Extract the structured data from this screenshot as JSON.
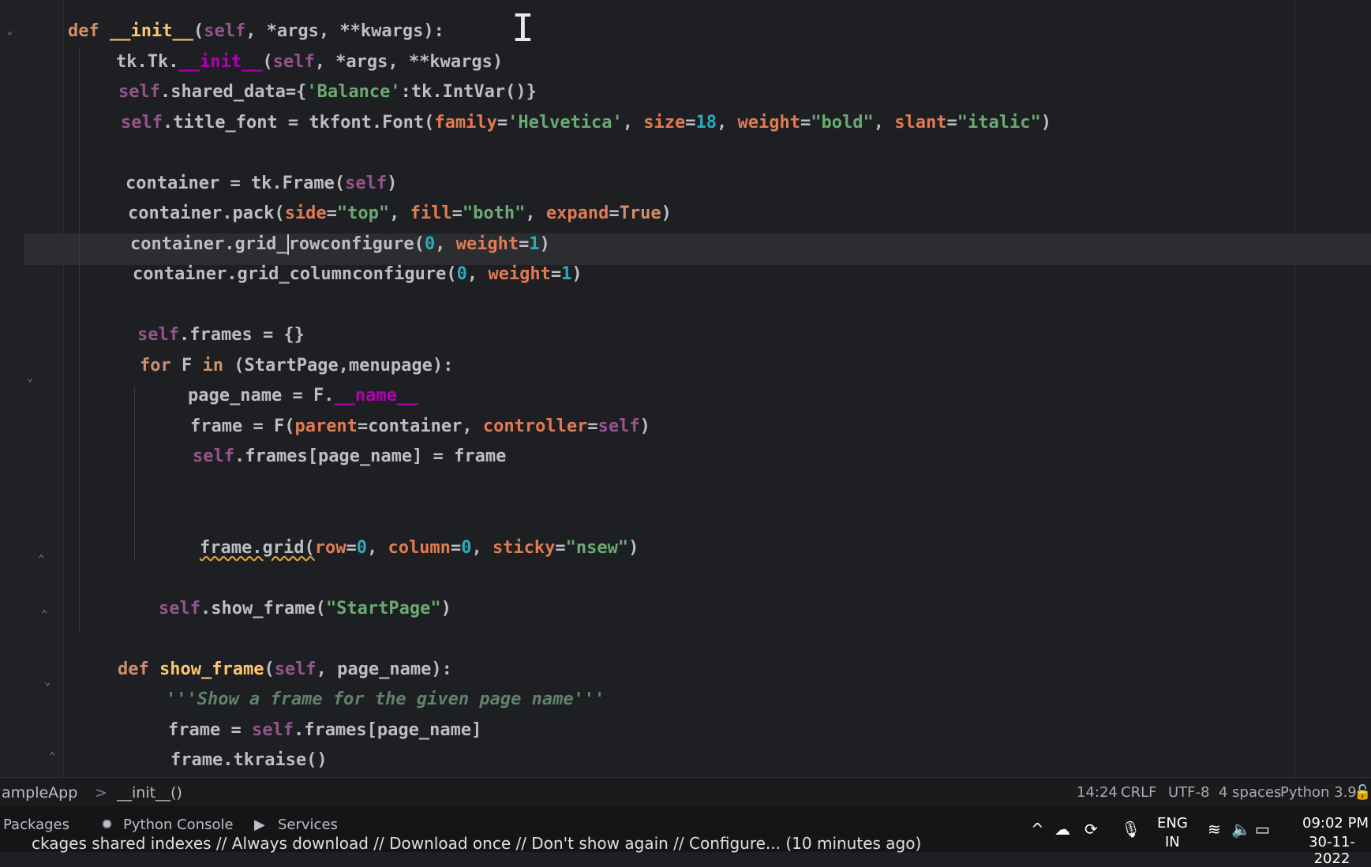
{
  "editor": {
    "lines": [
      {
        "indent": 0,
        "tokens": [
          [
            "kw",
            "def "
          ],
          [
            "def",
            "__init__"
          ],
          [
            "plain",
            "("
          ],
          [
            "self",
            "self"
          ],
          [
            "plain",
            ", *args, **kwargs):"
          ]
        ]
      },
      {
        "indent": 1,
        "tokens": [
          [
            "plain",
            "tk.Tk."
          ],
          [
            "dunder",
            "__init__"
          ],
          [
            "plain",
            "("
          ],
          [
            "self",
            "self"
          ],
          [
            "plain",
            ", *args, **kwargs)"
          ]
        ]
      },
      {
        "indent": 1,
        "tokens": [
          [
            "self",
            "self"
          ],
          [
            "plain",
            ".shared_data={"
          ],
          [
            "str",
            "'Balance'"
          ],
          [
            "plain",
            ":tk.IntVar()}"
          ]
        ]
      },
      {
        "indent": 1,
        "tokens": [
          [
            "self",
            "self"
          ],
          [
            "plain",
            ".title_font = tkfont.Font("
          ],
          [
            "param",
            "family"
          ],
          [
            "plain",
            "="
          ],
          [
            "str",
            "'Helvetica'"
          ],
          [
            "plain",
            ", "
          ],
          [
            "param",
            "size"
          ],
          [
            "plain",
            "="
          ],
          [
            "num",
            "18"
          ],
          [
            "plain",
            ", "
          ],
          [
            "param",
            "weight"
          ],
          [
            "plain",
            "="
          ],
          [
            "str",
            "\"bold\""
          ],
          [
            "plain",
            ", "
          ],
          [
            "param",
            "slant"
          ],
          [
            "plain",
            "="
          ],
          [
            "str",
            "\"italic\""
          ],
          [
            "plain",
            ")"
          ]
        ]
      },
      {
        "indent": 1,
        "tokens": []
      },
      {
        "indent": 1,
        "tokens": [
          [
            "plain",
            "container = tk.Frame("
          ],
          [
            "self",
            "self"
          ],
          [
            "plain",
            ")"
          ]
        ]
      },
      {
        "indent": 1,
        "tokens": [
          [
            "plain",
            "container.pack("
          ],
          [
            "param",
            "side"
          ],
          [
            "plain",
            "="
          ],
          [
            "str",
            "\"top\""
          ],
          [
            "plain",
            ", "
          ],
          [
            "param",
            "fill"
          ],
          [
            "plain",
            "="
          ],
          [
            "str",
            "\"both\""
          ],
          [
            "plain",
            ", "
          ],
          [
            "param",
            "expand"
          ],
          [
            "plain",
            "="
          ],
          [
            "kw",
            "True"
          ],
          [
            "plain",
            ")"
          ]
        ]
      },
      {
        "indent": 1,
        "tokens": [
          [
            "plain",
            "container.grid_"
          ],
          [
            "cursor",
            ""
          ],
          [
            "plain",
            "rowconfigure("
          ],
          [
            "num",
            "0"
          ],
          [
            "plain",
            ", "
          ],
          [
            "param",
            "weight"
          ],
          [
            "plain",
            "="
          ],
          [
            "num",
            "1"
          ],
          [
            "plain",
            ")"
          ]
        ]
      },
      {
        "indent": 1,
        "tokens": [
          [
            "plain",
            "container.grid_columnconfigure("
          ],
          [
            "num",
            "0"
          ],
          [
            "plain",
            ", "
          ],
          [
            "param",
            "weight"
          ],
          [
            "plain",
            "="
          ],
          [
            "num",
            "1"
          ],
          [
            "plain",
            ")"
          ]
        ]
      },
      {
        "indent": 1,
        "tokens": []
      },
      {
        "indent": 1,
        "tokens": [
          [
            "self",
            "self"
          ],
          [
            "plain",
            ".frames = {}"
          ]
        ]
      },
      {
        "indent": 1,
        "tokens": [
          [
            "kw",
            "for "
          ],
          [
            "plain",
            "F "
          ],
          [
            "kw",
            "in "
          ],
          [
            "plain",
            "(StartPage,menupage):"
          ]
        ]
      },
      {
        "indent": 2,
        "tokens": [
          [
            "plain",
            "page_name = F."
          ],
          [
            "dunder",
            "__name__"
          ]
        ]
      },
      {
        "indent": 2,
        "tokens": [
          [
            "plain",
            "frame = F("
          ],
          [
            "param",
            "parent"
          ],
          [
            "plain",
            "=container, "
          ],
          [
            "param",
            "controller"
          ],
          [
            "plain",
            "="
          ],
          [
            "self",
            "self"
          ],
          [
            "plain",
            ")"
          ]
        ]
      },
      {
        "indent": 2,
        "tokens": [
          [
            "self",
            "self"
          ],
          [
            "plain",
            ".frames[page_name] = frame"
          ]
        ]
      },
      {
        "indent": 2,
        "tokens": []
      },
      {
        "indent": 2,
        "tokens": []
      },
      {
        "indent": 2,
        "tokens": [
          [
            "under",
            "frame.grid("
          ],
          [
            "param",
            "row"
          ],
          [
            "plain",
            "="
          ],
          [
            "num",
            "0"
          ],
          [
            "plain",
            ", "
          ],
          [
            "param",
            "column"
          ],
          [
            "plain",
            "="
          ],
          [
            "num",
            "0"
          ],
          [
            "plain",
            ", "
          ],
          [
            "param",
            "sticky"
          ],
          [
            "plain",
            "="
          ],
          [
            "str",
            "\"nsew\""
          ],
          [
            "plain",
            ")"
          ]
        ]
      },
      {
        "indent": 1,
        "tokens": []
      },
      {
        "indent": 1,
        "tokens": [
          [
            "self",
            "self"
          ],
          [
            "plain",
            ".show_frame("
          ],
          [
            "str",
            "\"StartPage\""
          ],
          [
            "plain",
            ")"
          ]
        ]
      },
      {
        "indent": 0,
        "tokens": []
      },
      {
        "indent": 0,
        "tokens": [
          [
            "kw",
            "def "
          ],
          [
            "def",
            "show_frame"
          ],
          [
            "plain",
            "("
          ],
          [
            "self",
            "self"
          ],
          [
            "plain",
            ", page_name):"
          ]
        ]
      },
      {
        "indent": 1,
        "tokens": [
          [
            "doc",
            "'''Show a frame for the given page name'''"
          ]
        ]
      },
      {
        "indent": 1,
        "tokens": [
          [
            "plain",
            "frame = "
          ],
          [
            "self",
            "self"
          ],
          [
            "plain",
            ".frames[page_name]"
          ]
        ]
      },
      {
        "indent": 1,
        "tokens": [
          [
            "plain",
            "frame.tkraise()"
          ]
        ]
      }
    ]
  },
  "breadcrumb": {
    "class_name": "ampleApp",
    "separator": ">",
    "method_name": "__init__()"
  },
  "status": {
    "position": "14:24",
    "line_ending": "CRLF",
    "encoding": "UTF-8",
    "indent": "4 spaces",
    "interpreter": "Python 3.9"
  },
  "notification": "Download pre-built shared indexes: Reduce the indexing time and CPU load with pre-built Python packages shared indexes // Always download // Download once // Don't show again // Configure... (10 minutes ago)",
  "notification_visible": "ckages shared indexes // Always download // Download once // Don't show again // Configure... (10 minutes ago)",
  "tool_windows": {
    "packages": "Packages",
    "python_console": "Python Console",
    "services": "Services"
  },
  "taskbar": {
    "lang_top": "ENG",
    "lang_bottom": "IN",
    "time": "09:02 PM",
    "date": "30-11-2022"
  },
  "colors": {
    "background": "#1e1f22",
    "keyword": "#cf8e6d",
    "string": "#6aab73",
    "number": "#2aacb8"
  }
}
